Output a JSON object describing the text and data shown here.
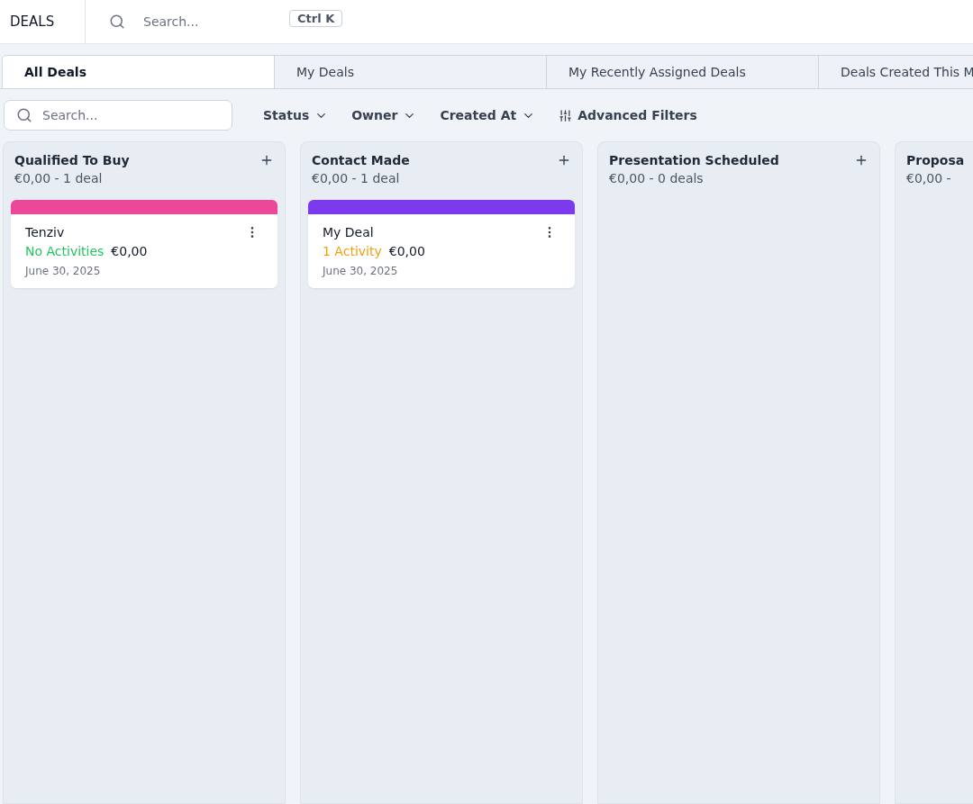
{
  "header": {
    "title": "DEALS",
    "search": {
      "placeholder": "Search..."
    },
    "shortcut": "Ctrl K"
  },
  "tabs": [
    {
      "label": "All Deals",
      "selected": true
    },
    {
      "label": "My Deals",
      "selected": false
    },
    {
      "label": "My Recently Assigned Deals",
      "selected": false
    },
    {
      "label": "Deals Created This M",
      "selected": false
    }
  ],
  "toolbar": {
    "search": {
      "placeholder": "Search..."
    },
    "filters": [
      "Status",
      "Owner",
      "Created At"
    ],
    "advanced": "Advanced Filters"
  },
  "columns": [
    {
      "title": "Qualified To Buy",
      "summary": "€0,00 - 1 deal",
      "add": true,
      "cards": [
        {
          "name": "Tenziv",
          "color": "#ec4899",
          "activity": {
            "label": "No Activities",
            "color": "#22c55e"
          },
          "amount": "€0,00",
          "date": "June 30, 2025"
        }
      ]
    },
    {
      "title": "Contact Made",
      "summary": "€0,00 - 1 deal",
      "add": true,
      "cards": [
        {
          "name": "My Deal",
          "color": "#7c3aed",
          "activity": {
            "label": "1 Activity",
            "color": "#f59e0b"
          },
          "amount": "€0,00",
          "date": "June 30, 2025"
        }
      ]
    },
    {
      "title": "Presentation Scheduled",
      "summary": "€0,00 - 0 deals",
      "add": true
    },
    {
      "title": "Proposa",
      "summary": "€0,00 -"
    }
  ]
}
